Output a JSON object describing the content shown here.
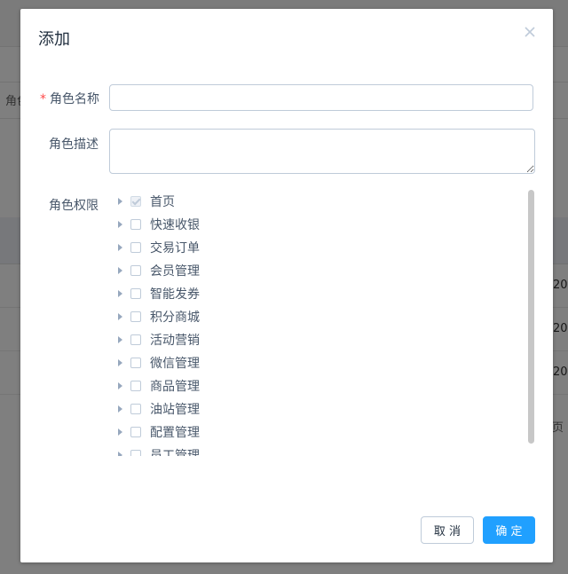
{
  "background": {
    "filter_label": "角色",
    "row_cells": [
      "20",
      "20",
      "20"
    ],
    "pagination_text": "页"
  },
  "dialog": {
    "title": "添加",
    "close_icon": "close-icon"
  },
  "form": {
    "name_label": "角色名称",
    "name_required_mark": "*",
    "name_value": "",
    "desc_label": "角色描述",
    "desc_value": "",
    "perm_label": "角色权限"
  },
  "tree": {
    "nodes": [
      {
        "label": "首页",
        "checked": true
      },
      {
        "label": "快速收银",
        "checked": false
      },
      {
        "label": "交易订单",
        "checked": false
      },
      {
        "label": "会员管理",
        "checked": false
      },
      {
        "label": "智能发券",
        "checked": false
      },
      {
        "label": "积分商城",
        "checked": false
      },
      {
        "label": "活动营销",
        "checked": false
      },
      {
        "label": "微信管理",
        "checked": false
      },
      {
        "label": "商品管理",
        "checked": false
      },
      {
        "label": "油站管理",
        "checked": false
      },
      {
        "label": "配置管理",
        "checked": false
      },
      {
        "label": "员工管理",
        "checked": false
      }
    ]
  },
  "footer": {
    "cancel_label": "取 消",
    "ok_label": "确 定"
  },
  "colors": {
    "primary": "#20a0ff",
    "required": "#ff4949",
    "overlay": "#000000"
  }
}
